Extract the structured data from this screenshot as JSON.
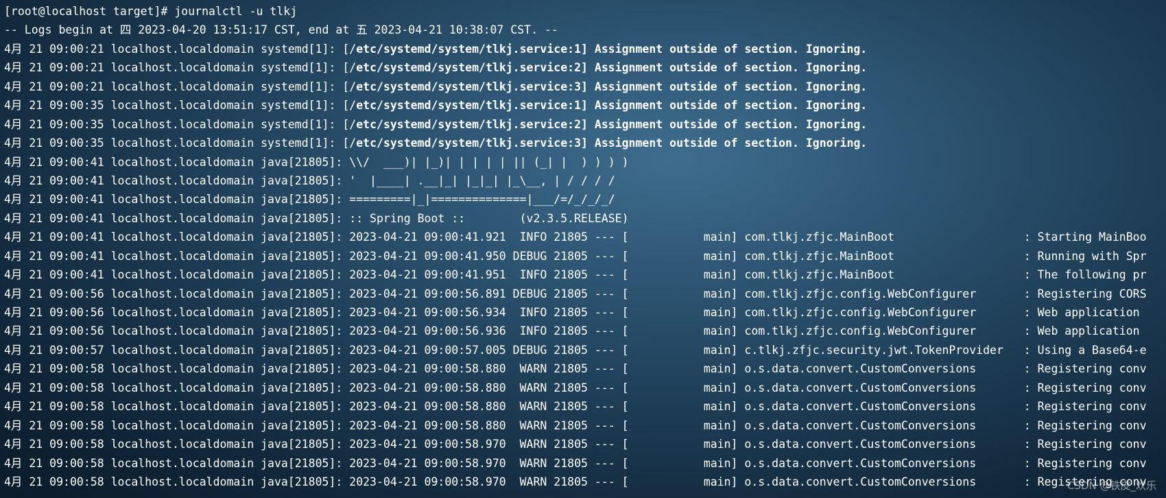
{
  "terminal": {
    "lines": [
      {
        "text": "[root@localhost target]# journalctl -u tlkj",
        "bold_prefix": 0
      },
      {
        "text": "-- Logs begin at 四 2023-04-20 13:51:17 CST, end at 五 2023-04-21 10:38:07 CST. --",
        "bold_prefix": 0
      },
      {
        "text": "4月 21 09:00:21 localhost.localdomain systemd[1]: [/etc/systemd/system/tlkj.service:1] Assignment outside of section. Ignoring.",
        "bold_prefix": 51
      },
      {
        "text": "4月 21 09:00:21 localhost.localdomain systemd[1]: [/etc/systemd/system/tlkj.service:2] Assignment outside of section. Ignoring.",
        "bold_prefix": 51
      },
      {
        "text": "4月 21 09:00:21 localhost.localdomain systemd[1]: [/etc/systemd/system/tlkj.service:3] Assignment outside of section. Ignoring.",
        "bold_prefix": 51
      },
      {
        "text": "4月 21 09:00:35 localhost.localdomain systemd[1]: [/etc/systemd/system/tlkj.service:1] Assignment outside of section. Ignoring.",
        "bold_prefix": 51
      },
      {
        "text": "4月 21 09:00:35 localhost.localdomain systemd[1]: [/etc/systemd/system/tlkj.service:2] Assignment outside of section. Ignoring.",
        "bold_prefix": 51
      },
      {
        "text": "4月 21 09:00:35 localhost.localdomain systemd[1]: [/etc/systemd/system/tlkj.service:3] Assignment outside of section. Ignoring.",
        "bold_prefix": 51
      },
      {
        "text": "4月 21 09:00:41 localhost.localdomain java[21805]: \\\\/  ___)| |_)| | | | | || (_| |  ) ) ) )",
        "bold_prefix": 0
      },
      {
        "text": "4月 21 09:00:41 localhost.localdomain java[21805]: '  |____| .__|_| |_|_| |_\\__, | / / / /",
        "bold_prefix": 0
      },
      {
        "text": "4月 21 09:00:41 localhost.localdomain java[21805]: =========|_|==============|___/=/_/_/_/",
        "bold_prefix": 0
      },
      {
        "text": "4月 21 09:00:41 localhost.localdomain java[21805]: :: Spring Boot ::        (v2.3.5.RELEASE)",
        "bold_prefix": 0
      },
      {
        "text": "4月 21 09:00:41 localhost.localdomain java[21805]: 2023-04-21 09:00:41.921  INFO 21805 --- [           main] com.tlkj.zfjc.MainBoot                   : Starting MainBoo",
        "bold_prefix": 0
      },
      {
        "text": "4月 21 09:00:41 localhost.localdomain java[21805]: 2023-04-21 09:00:41.950 DEBUG 21805 --- [           main] com.tlkj.zfjc.MainBoot                   : Running with Spr",
        "bold_prefix": 0
      },
      {
        "text": "4月 21 09:00:41 localhost.localdomain java[21805]: 2023-04-21 09:00:41.951  INFO 21805 --- [           main] com.tlkj.zfjc.MainBoot                   : The following pr",
        "bold_prefix": 0
      },
      {
        "text": "4月 21 09:00:56 localhost.localdomain java[21805]: 2023-04-21 09:00:56.891 DEBUG 21805 --- [           main] com.tlkj.zfjc.config.WebConfigurer       : Registering CORS",
        "bold_prefix": 0
      },
      {
        "text": "4月 21 09:00:56 localhost.localdomain java[21805]: 2023-04-21 09:00:56.934  INFO 21805 --- [           main] com.tlkj.zfjc.config.WebConfigurer       : Web application ",
        "bold_prefix": 0
      },
      {
        "text": "4月 21 09:00:56 localhost.localdomain java[21805]: 2023-04-21 09:00:56.936  INFO 21805 --- [           main] com.tlkj.zfjc.config.WebConfigurer       : Web application ",
        "bold_prefix": 0
      },
      {
        "text": "4月 21 09:00:57 localhost.localdomain java[21805]: 2023-04-21 09:00:57.005 DEBUG 21805 --- [           main] c.tlkj.zfjc.security.jwt.TokenProvider   : Using a Base64-e",
        "bold_prefix": 0
      },
      {
        "text": "4月 21 09:00:58 localhost.localdomain java[21805]: 2023-04-21 09:00:58.880  WARN 21805 --- [           main] o.s.data.convert.CustomConversions       : Registering conv",
        "bold_prefix": 0
      },
      {
        "text": "4月 21 09:00:58 localhost.localdomain java[21805]: 2023-04-21 09:00:58.880  WARN 21805 --- [           main] o.s.data.convert.CustomConversions       : Registering conv",
        "bold_prefix": 0
      },
      {
        "text": "4月 21 09:00:58 localhost.localdomain java[21805]: 2023-04-21 09:00:58.880  WARN 21805 --- [           main] o.s.data.convert.CustomConversions       : Registering conv",
        "bold_prefix": 0
      },
      {
        "text": "4月 21 09:00:58 localhost.localdomain java[21805]: 2023-04-21 09:00:58.880  WARN 21805 --- [           main] o.s.data.convert.CustomConversions       : Registering conv",
        "bold_prefix": 0
      },
      {
        "text": "4月 21 09:00:58 localhost.localdomain java[21805]: 2023-04-21 09:00:58.970  WARN 21805 --- [           main] o.s.data.convert.CustomConversions       : Registering conv",
        "bold_prefix": 0
      },
      {
        "text": "4月 21 09:00:58 localhost.localdomain java[21805]: 2023-04-21 09:00:58.970  WARN 21805 --- [           main] o.s.data.convert.CustomConversions       : Registering conv",
        "bold_prefix": 0
      },
      {
        "text": "4月 21 09:00:58 localhost.localdomain java[21805]: 2023-04-21 09:00:58.970  WARN 21805 --- [           main] o.s.data.convert.CustomConversions       : Registering conv",
        "bold_prefix": 0
      }
    ],
    "text_color": "#ffffff",
    "background_color": "#2c5370"
  },
  "watermark": "CSDN @铁皮_欢乐"
}
